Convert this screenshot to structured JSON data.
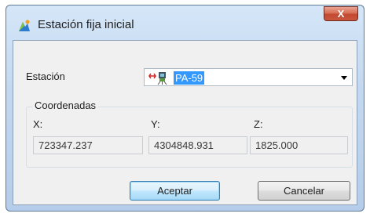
{
  "window": {
    "title": "Estación fija inicial",
    "close_label": "X"
  },
  "station": {
    "label": "Estación",
    "selected_value": "PA-59",
    "icon": "survey-station-icon"
  },
  "coordinates": {
    "group_label": "Coordenadas",
    "x_label": "X:",
    "y_label": "Y:",
    "z_label": "Z:",
    "x_value": "723347.237",
    "y_value": "4304848.931",
    "z_value": "1825.000"
  },
  "buttons": {
    "accept_label": "Aceptar",
    "cancel_label": "Cancelar"
  },
  "colors": {
    "selection": "#3399ff",
    "close_button": "#c8573e",
    "title_bar": "#c3d8f0"
  }
}
